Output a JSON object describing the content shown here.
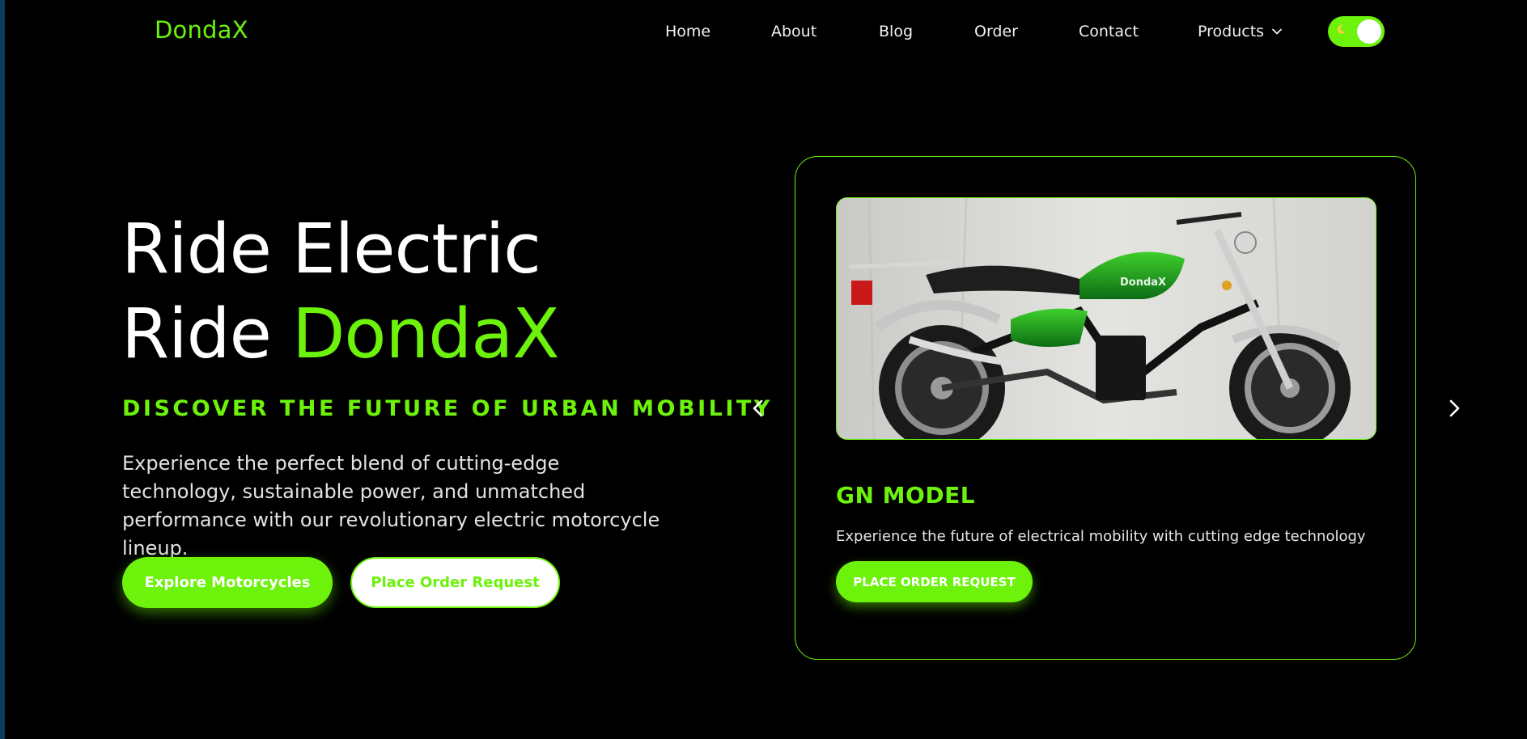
{
  "brand": {
    "name": "DondaX",
    "accent_color": "#6cf20b",
    "background": "#000000"
  },
  "nav": {
    "items": [
      {
        "label": "Home"
      },
      {
        "label": "About"
      },
      {
        "label": "Blog"
      },
      {
        "label": "Order"
      },
      {
        "label": "Contact"
      },
      {
        "label": "Products",
        "has_dropdown": true
      }
    ],
    "theme_toggle": {
      "state": "on",
      "icon": "moon-icon"
    }
  },
  "hero": {
    "title_line1": "Ride Electric",
    "title_line2_prefix": "Ride ",
    "title_line2_accent": "DondaX",
    "kicker": "DISCOVER THE FUTURE OF URBAN MOBILITY",
    "description": "Experience the perfect blend of cutting-edge technology, sustainable power, and unmatched performance with our revolutionary electric motorcycle lineup.",
    "primary_button": "Explore Motorcycles",
    "secondary_button": "Place Order Request"
  },
  "carousel": {
    "prev_icon": "chevron-left-icon",
    "next_icon": "chevron-right-icon",
    "card": {
      "image_logo_text": "DondaX",
      "model": "GN MODEL",
      "description": "Experience the future of electrical mobility with cutting edge technology",
      "button": "PLACE ORDER REQUEST"
    }
  }
}
